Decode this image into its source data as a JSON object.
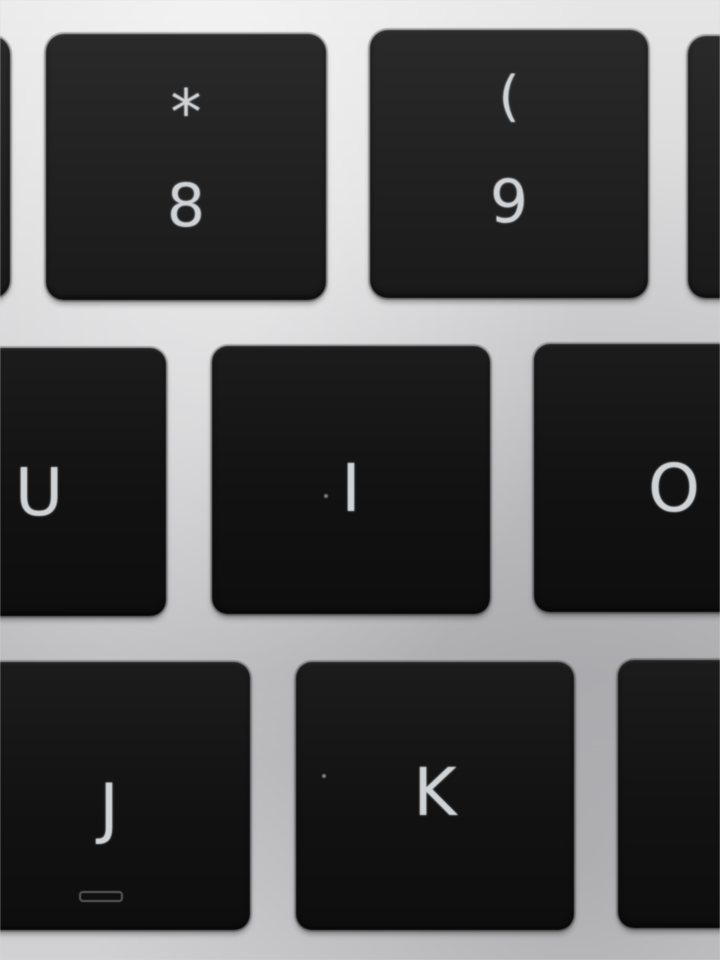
{
  "keys": {
    "key_8": {
      "shift": "*",
      "main": "8"
    },
    "key_9": {
      "shift": "(",
      "main": "9"
    },
    "key_u": {
      "main": "U"
    },
    "key_i": {
      "main": "I"
    },
    "key_o": {
      "main": "O"
    },
    "key_j": {
      "main": "J"
    },
    "key_k": {
      "main": "K"
    }
  },
  "colors": {
    "keycap": "#141414",
    "legend": "#cfd3d6",
    "deck": "#cfcfd1"
  }
}
